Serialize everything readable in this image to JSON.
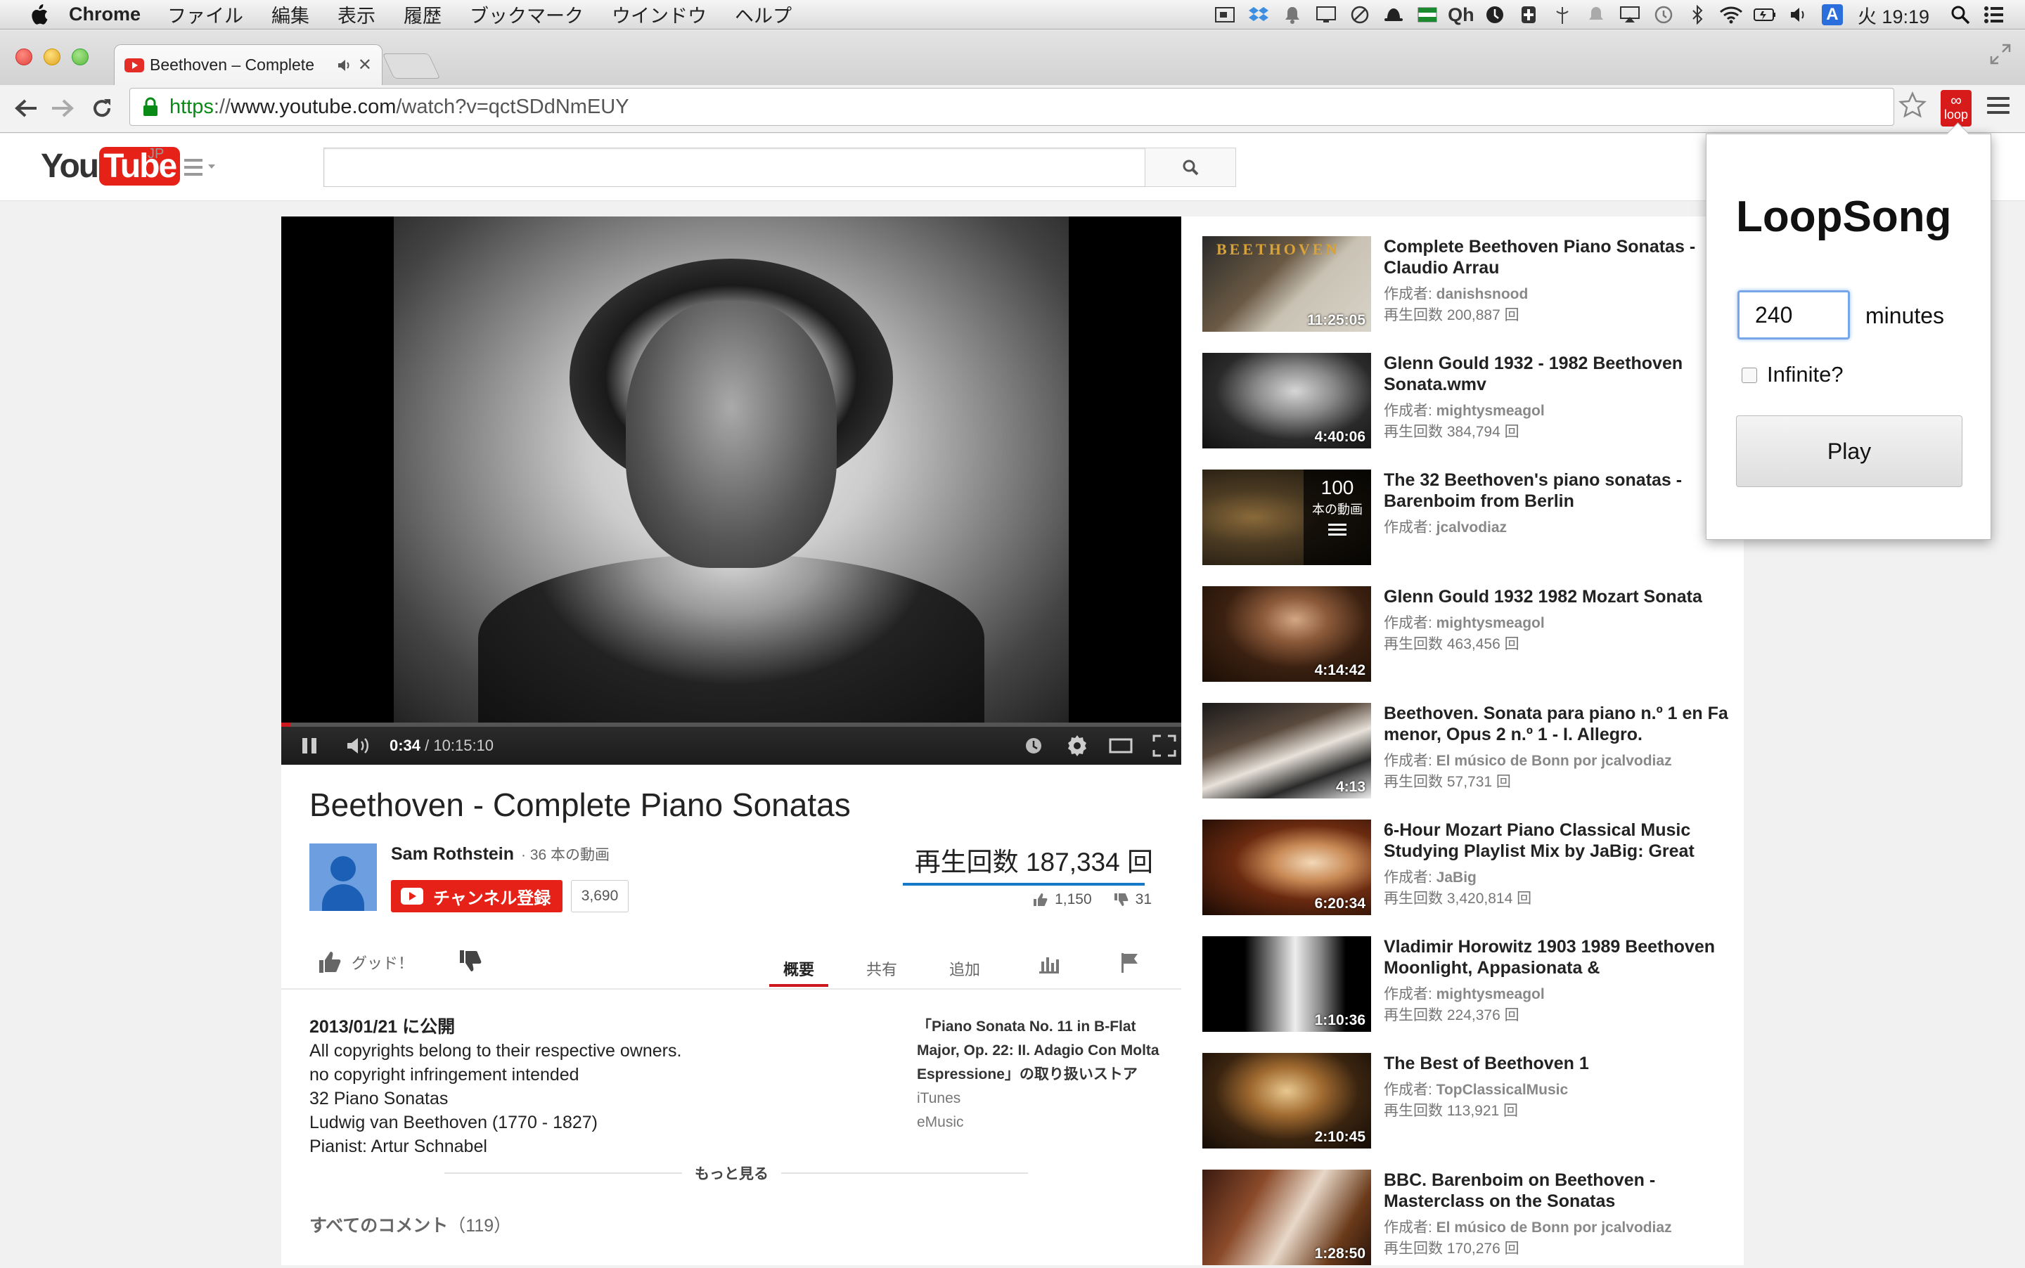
{
  "macos": {
    "app_name": "Chrome",
    "menus": [
      "ファイル",
      "編集",
      "表示",
      "履歴",
      "ブックマーク",
      "ウインドウ",
      "ヘルプ"
    ],
    "tray_text_qh": "Qh",
    "tray_text_a": "A",
    "clock": "火 19:19"
  },
  "browser": {
    "tab_title": "Beethoven – Complete",
    "url": {
      "scheme": "https",
      "separator": "://",
      "host": "www.youtube.com",
      "path": "/watch?v=qctSDdNmEUY"
    },
    "extension_label": "loop",
    "extension_symbol": "∞"
  },
  "youtube": {
    "logo_you": "You",
    "logo_tube": "Tube",
    "logo_region": "JP",
    "player": {
      "current_time": "0:34",
      "separator": " / ",
      "duration": "10:15:10",
      "progress_fraction": 0.0009
    },
    "video": {
      "title": "Beethoven - Complete Piano Sonatas",
      "channel": "Sam Rothstein",
      "channel_video_count": "· 36 本の動画",
      "subscribe_label": "チャンネル登録",
      "subscriber_count": "3,690",
      "views": "再生回数 187,334 回",
      "likes": "1,150",
      "dislikes": "31"
    },
    "actions": {
      "like_label": "グッド！",
      "tabs": [
        "概要",
        "共有",
        "追加"
      ]
    },
    "description": {
      "published": "2013/01/21 に公開",
      "lines": [
        "All copyrights belong to their respective owners.",
        "no copyright infringement intended",
        "32 Piano Sonatas",
        "Ludwig van Beethoven (1770 - 1827)",
        "Pianist: Artur Schnabel"
      ],
      "store_song": "「Piano Sonata No. 11 in B-Flat Major, Op. 22: II. Adagio Con Molta Espressione」の取り扱いストア",
      "store_links": [
        "iTunes",
        "eMusic"
      ],
      "show_more": "もっと見る"
    },
    "comments": {
      "label": "すべてのコメント",
      "count": "（119）"
    },
    "related": [
      {
        "title": "Complete Beethoven Piano Sonatas - Claudio Arrau",
        "author_prefix": "作成者: ",
        "author": "danishsnood",
        "views": "再生回数 200,887 回",
        "duration": "11:25:05"
      },
      {
        "title": "Glenn Gould 1932 - 1982 Beethoven Sonata.wmv",
        "author_prefix": "作成者: ",
        "author": "mightysmeagol",
        "views": "再生回数 384,794 回",
        "duration": "4:40:06"
      },
      {
        "title": "The 32 Beethoven's piano sonatas - Barenboim from Berlin",
        "author_prefix": "作成者: ",
        "author": "jcalvodiaz",
        "views": "",
        "duration": "",
        "playlist_count": "100",
        "playlist_label": "本の動画"
      },
      {
        "title": "Glenn Gould 1932 1982 Mozart Sonata",
        "author_prefix": "作成者: ",
        "author": "mightysmeagol",
        "views": "再生回数 463,456 回",
        "duration": "4:14:42"
      },
      {
        "title": "Beethoven. Sonata para piano n.º 1 en Fa menor, Opus 2 n.º 1 - I. Allegro.",
        "author_prefix": "作成者: ",
        "author": "El músico de Bonn por jcalvodiaz",
        "views": "再生回数 57,731 回",
        "duration": "4:13"
      },
      {
        "title": "6-Hour Mozart Piano Classical Music Studying Playlist Mix by JaBig: Great",
        "author_prefix": "作成者: ",
        "author": "JaBig",
        "views": "再生回数 3,420,814 回",
        "duration": "6:20:34"
      },
      {
        "title": "Vladimir Horowitz 1903 1989 Beethoven Moonlight, Appasionata &",
        "author_prefix": "作成者: ",
        "author": "mightysmeagol",
        "views": "再生回数 224,376 回",
        "duration": "1:10:36"
      },
      {
        "title": "The Best of Beethoven 1",
        "author_prefix": "作成者: ",
        "author": "TopClassicalMusic",
        "views": "再生回数 113,921 回",
        "duration": "2:10:45"
      },
      {
        "title": "BBC. Barenboim on Beethoven - Masterclass on the Sonatas",
        "author_prefix": "作成者: ",
        "author": "El músico de Bonn por jcalvodiaz",
        "views": "再生回数 170,276 回",
        "duration": "1:28:50"
      }
    ]
  },
  "loopsong": {
    "title": "LoopSong",
    "minutes_value": "240",
    "minutes_label": "minutes",
    "infinite_label": "Infinite?",
    "infinite_checked": false,
    "play_label": "Play"
  },
  "colors": {
    "youtube_red": "#e62117",
    "progress_red": "#cc181e",
    "link_blue": "#167ac6",
    "https_green": "#0a8a16"
  }
}
